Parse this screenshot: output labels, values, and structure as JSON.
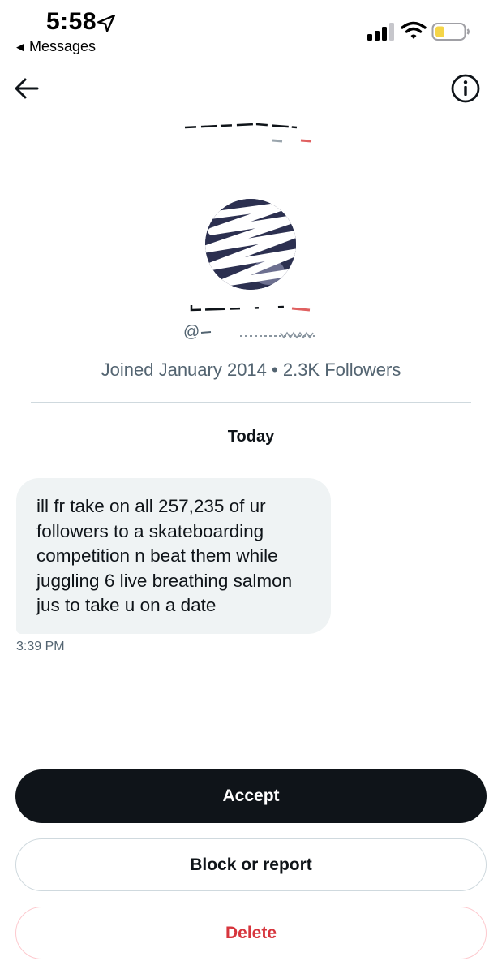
{
  "status_bar": {
    "time": "5:58",
    "back_app": "Messages"
  },
  "icons": {
    "status": [
      "location-arrow-icon",
      "cellular-signal-icon",
      "wifi-icon",
      "battery-low-icon"
    ],
    "nav": [
      "back-arrow-icon",
      "info-icon"
    ]
  },
  "profile": {
    "handle_prefix": "@",
    "meta": "Joined January 2014 • 2.3K Followers"
  },
  "conversation": {
    "date_label": "Today",
    "messages": [
      {
        "lines": [
          "ill fr take on all 257,235 of ur",
          "followers to a skateboarding",
          "competition n beat them while",
          "juggling 6 live breathing salmon",
          "jus to take u on a date"
        ],
        "time": "3:39 PM"
      }
    ]
  },
  "actions": {
    "accept": "Accept",
    "block_or_report": "Block or report",
    "delete": "Delete"
  },
  "colors": {
    "primary_text": "#0f1419",
    "secondary_text": "#536471",
    "bubble_bg": "#eff3f4",
    "accept_bg": "#0f1419",
    "delete_red": "#d7353d",
    "battery_yellow": "#f5d548"
  }
}
